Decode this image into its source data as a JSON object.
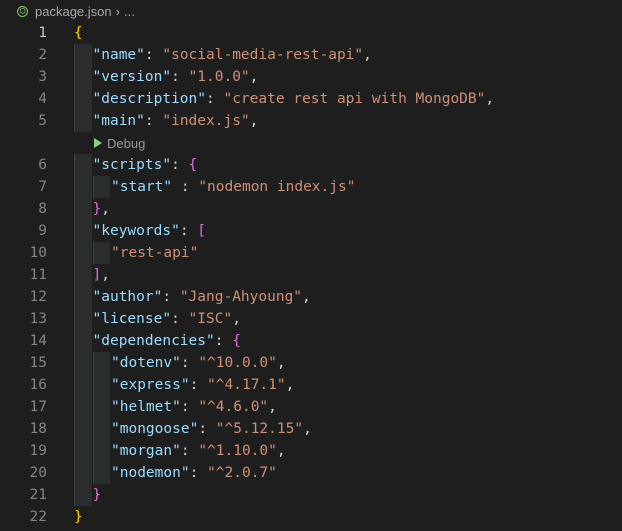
{
  "breadcrumb": {
    "file": "package.json",
    "separator": "›",
    "more": "..."
  },
  "codelens": {
    "label": "Debug"
  },
  "lines": [
    {
      "num": "1",
      "tokens": [
        {
          "t": "{",
          "c": "b1"
        }
      ]
    },
    {
      "num": "2",
      "tokens": [
        {
          "t": "\"name\"",
          "c": "k"
        },
        {
          "t": ": ",
          "c": "p"
        },
        {
          "t": "\"social-media-rest-api\"",
          "c": "s"
        },
        {
          "t": ",",
          "c": "p"
        }
      ]
    },
    {
      "num": "3",
      "tokens": [
        {
          "t": "\"version\"",
          "c": "k"
        },
        {
          "t": ": ",
          "c": "p"
        },
        {
          "t": "\"1.0.0\"",
          "c": "s"
        },
        {
          "t": ",",
          "c": "p"
        }
      ]
    },
    {
      "num": "4",
      "tokens": [
        {
          "t": "\"description\"",
          "c": "k"
        },
        {
          "t": ": ",
          "c": "p"
        },
        {
          "t": "\"create rest api with MongoDB\"",
          "c": "s"
        },
        {
          "t": ",",
          "c": "p"
        }
      ]
    },
    {
      "num": "5",
      "tokens": [
        {
          "t": "\"main\"",
          "c": "k"
        },
        {
          "t": ": ",
          "c": "p"
        },
        {
          "t": "\"index.js\"",
          "c": "s"
        },
        {
          "t": ",",
          "c": "p"
        }
      ]
    },
    {
      "num": "6",
      "tokens": [
        {
          "t": "\"scripts\"",
          "c": "k"
        },
        {
          "t": ": ",
          "c": "p"
        },
        {
          "t": "{",
          "c": "b2"
        }
      ]
    },
    {
      "num": "7",
      "tokens": [
        {
          "t": "\"start\"",
          "c": "k"
        },
        {
          "t": " : ",
          "c": "p"
        },
        {
          "t": "\"nodemon index.js\"",
          "c": "s"
        }
      ]
    },
    {
      "num": "8",
      "tokens": [
        {
          "t": "}",
          "c": "b2"
        },
        {
          "t": ",",
          "c": "p"
        }
      ]
    },
    {
      "num": "9",
      "tokens": [
        {
          "t": "\"keywords\"",
          "c": "k"
        },
        {
          "t": ": ",
          "c": "p"
        },
        {
          "t": "[",
          "c": "b2"
        }
      ]
    },
    {
      "num": "10",
      "tokens": [
        {
          "t": "\"rest-api\"",
          "c": "s"
        }
      ]
    },
    {
      "num": "11",
      "tokens": [
        {
          "t": "]",
          "c": "b2"
        },
        {
          "t": ",",
          "c": "p"
        }
      ]
    },
    {
      "num": "12",
      "tokens": [
        {
          "t": "\"author\"",
          "c": "k"
        },
        {
          "t": ": ",
          "c": "p"
        },
        {
          "t": "\"Jang-Ahyoung\"",
          "c": "s"
        },
        {
          "t": ",",
          "c": "p"
        }
      ]
    },
    {
      "num": "13",
      "tokens": [
        {
          "t": "\"license\"",
          "c": "k"
        },
        {
          "t": ": ",
          "c": "p"
        },
        {
          "t": "\"ISC\"",
          "c": "s"
        },
        {
          "t": ",",
          "c": "p"
        }
      ]
    },
    {
      "num": "14",
      "tokens": [
        {
          "t": "\"dependencies\"",
          "c": "k"
        },
        {
          "t": ": ",
          "c": "p"
        },
        {
          "t": "{",
          "c": "b2"
        }
      ]
    },
    {
      "num": "15",
      "tokens": [
        {
          "t": "\"dotenv\"",
          "c": "k"
        },
        {
          "t": ": ",
          "c": "p"
        },
        {
          "t": "\"^10.0.0\"",
          "c": "s"
        },
        {
          "t": ",",
          "c": "p"
        }
      ]
    },
    {
      "num": "16",
      "tokens": [
        {
          "t": "\"express\"",
          "c": "k"
        },
        {
          "t": ": ",
          "c": "p"
        },
        {
          "t": "\"^4.17.1\"",
          "c": "s"
        },
        {
          "t": ",",
          "c": "p"
        }
      ]
    },
    {
      "num": "17",
      "tokens": [
        {
          "t": "\"helmet\"",
          "c": "k"
        },
        {
          "t": ": ",
          "c": "p"
        },
        {
          "t": "\"^4.6.0\"",
          "c": "s"
        },
        {
          "t": ",",
          "c": "p"
        }
      ]
    },
    {
      "num": "18",
      "tokens": [
        {
          "t": "\"mongoose\"",
          "c": "k"
        },
        {
          "t": ": ",
          "c": "p"
        },
        {
          "t": "\"^5.12.15\"",
          "c": "s"
        },
        {
          "t": ",",
          "c": "p"
        }
      ]
    },
    {
      "num": "19",
      "tokens": [
        {
          "t": "\"morgan\"",
          "c": "k"
        },
        {
          "t": ": ",
          "c": "p"
        },
        {
          "t": "\"^1.10.0\"",
          "c": "s"
        },
        {
          "t": ",",
          "c": "p"
        }
      ]
    },
    {
      "num": "20",
      "tokens": [
        {
          "t": "\"nodemon\"",
          "c": "k"
        },
        {
          "t": ": ",
          "c": "p"
        },
        {
          "t": "\"^2.0.7\"",
          "c": "s"
        }
      ]
    },
    {
      "num": "21",
      "tokens": [
        {
          "t": "}",
          "c": "b2"
        }
      ]
    },
    {
      "num": "22",
      "tokens": [
        {
          "t": "}",
          "c": "b1"
        }
      ]
    }
  ],
  "colors": {
    "background": "#1e1e1e",
    "key": "#9cdcfe",
    "string": "#ce9178",
    "punctuation": "#d4d4d4",
    "bracket_level1": "#ffd700",
    "bracket_level2": "#da70d6",
    "line_number": "#858585",
    "codelens_icon": "#89d185"
  }
}
